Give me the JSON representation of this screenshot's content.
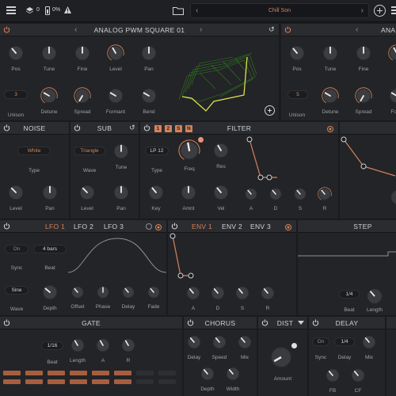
{
  "topbar": {
    "preset_name": "Chill Son",
    "layers_count": "0",
    "cpu_percent": "0%"
  },
  "osc1": {
    "title": "ANALOG PWM SQUARE 01",
    "knob_labels": [
      "Pos",
      "Tune",
      "Fine",
      "Level",
      "Pan",
      "Unison",
      "Detune",
      "Spread",
      "Formant",
      "Bend"
    ],
    "unison_value": "3"
  },
  "osc2": {
    "title": "ANA",
    "knob_labels": [
      "Pos",
      "Tune",
      "Fine",
      "Unison",
      "Detune",
      "Spread",
      "Form"
    ],
    "unison_value": "5"
  },
  "noise": {
    "title": "NOISE",
    "type_value": "White",
    "type_label": "Type",
    "knob_labels": [
      "Level",
      "Pan"
    ]
  },
  "sub": {
    "title": "SUB",
    "wave_value": "Triangle",
    "wave_label": "Wave",
    "knob_labels": [
      "Tune",
      "Level",
      "Pan"
    ]
  },
  "filter": {
    "title": "FILTER",
    "routes": [
      "1",
      "2",
      "S",
      "N"
    ],
    "type_value": "LP 12",
    "knob_labels": [
      "Type",
      "Freq",
      "Res",
      "Key",
      "Amnt",
      "Vel"
    ],
    "env_labels": [
      "A",
      "D",
      "S",
      "R"
    ]
  },
  "lfo": {
    "tabs": [
      "LFO 1",
      "LFO 2",
      "LFO 3"
    ],
    "sync_value": "On",
    "beat_value": "4 bars",
    "sync_label": "Sync",
    "beat_label": "Beat",
    "wave_value": "Sine",
    "wave_label": "Wave",
    "knob_labels": [
      "Depth",
      "Offset",
      "Phase",
      "Delay",
      "Fade"
    ]
  },
  "env": {
    "tabs": [
      "ENV 1",
      "ENV 2",
      "ENV 3"
    ],
    "knob_labels": [
      "A",
      "D",
      "S",
      "R"
    ]
  },
  "step": {
    "title": "STEP",
    "beat_value": "1/4",
    "labels": [
      "Beat",
      "Length"
    ]
  },
  "gate": {
    "title": "GATE",
    "beat_value": "1/16",
    "knob_labels": [
      "Beat",
      "Length",
      "A",
      "R"
    ]
  },
  "chorus": {
    "title": "CHORUS",
    "knob_labels": [
      "Delay",
      "Speed",
      "Mix",
      "Depth",
      "Width"
    ]
  },
  "dist": {
    "title": "DIST",
    "knob_label": "Amount"
  },
  "delay": {
    "title": "DELAY",
    "sync_value": "On",
    "beat_value": "1/4",
    "labels": [
      "Sync",
      "Delay",
      "Mix",
      "FB",
      "CF"
    ]
  },
  "colors": {
    "accent": "#d6825a",
    "bg": "#1a1b1e",
    "panel": "#232427",
    "graph_green": "#7ecb3a"
  }
}
